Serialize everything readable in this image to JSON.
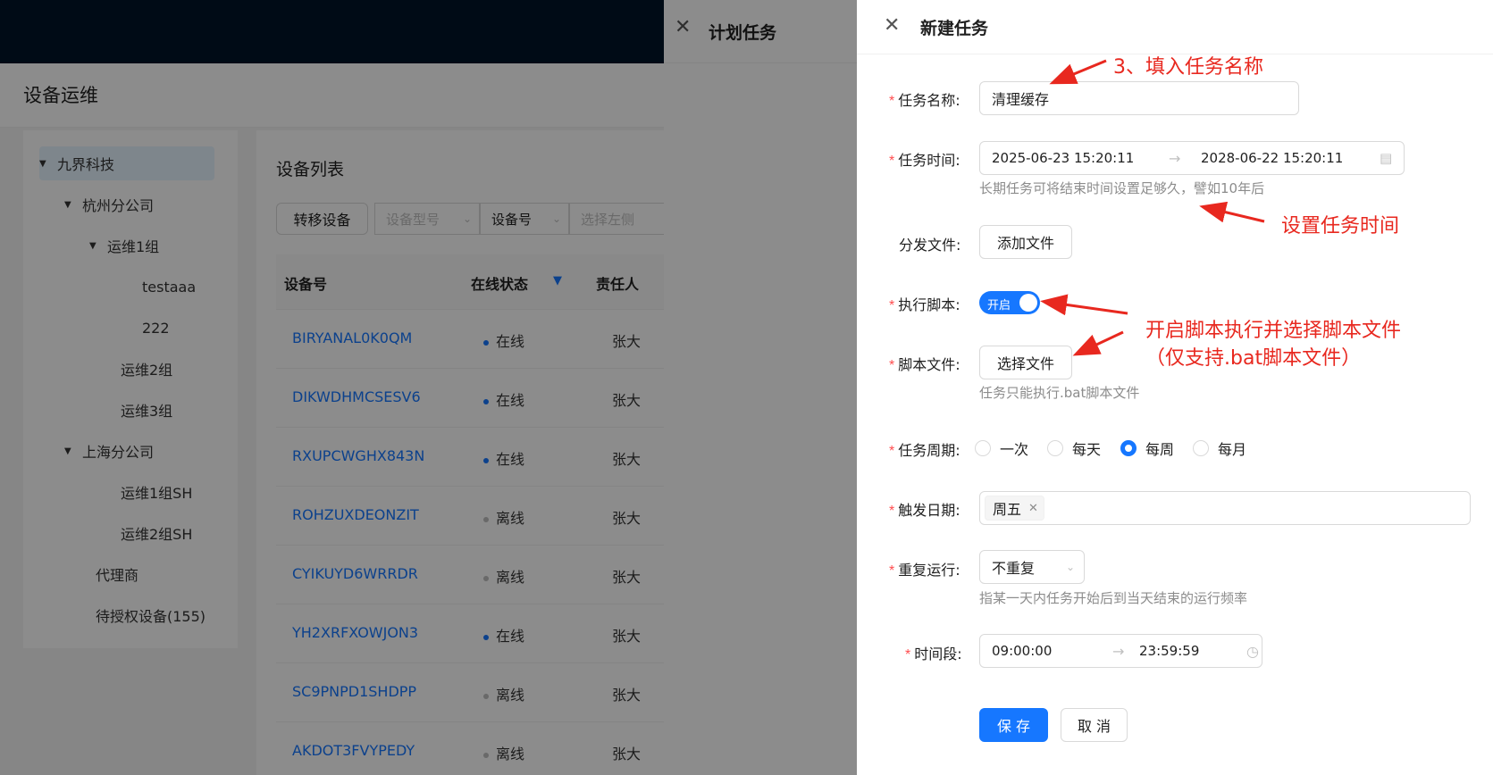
{
  "background": {
    "page_title": "设备运维",
    "tree": [
      {
        "label": "九界科技",
        "caret": "▼"
      },
      {
        "label": "杭州分公司",
        "caret": "▼"
      },
      {
        "label": "运维1组",
        "caret": "▼"
      },
      {
        "label": "testaaa",
        "caret": ""
      },
      {
        "label": "222",
        "caret": ""
      },
      {
        "label": "运维2组",
        "caret": ""
      },
      {
        "label": "运维3组",
        "caret": ""
      },
      {
        "label": "上海分公司",
        "caret": "▼"
      },
      {
        "label": "运维1组SH",
        "caret": ""
      },
      {
        "label": "运维2组SH",
        "caret": ""
      },
      {
        "label": "代理商",
        "caret": ""
      },
      {
        "label": "待授权设备(155)",
        "caret": ""
      }
    ],
    "list_title": "设备列表",
    "transfer_button": "转移设备",
    "filters": [
      "设备型号",
      "设备号",
      "选择左侧"
    ],
    "columns": [
      "设备号",
      "在线状态",
      "责任人"
    ],
    "rows": [
      {
        "id": "BIRYANAL0K0QM",
        "status": "在线",
        "owner": "张大"
      },
      {
        "id": "DIKWDHMCSESV6",
        "status": "在线",
        "owner": "张大"
      },
      {
        "id": "RXUPCWGHX843N",
        "status": "在线",
        "owner": "张大"
      },
      {
        "id": "ROHZUXDEONZIT",
        "status": "离线",
        "owner": "张大"
      },
      {
        "id": "CYIKUYD6WRRDR",
        "status": "离线",
        "owner": "张大"
      },
      {
        "id": "YH2XRFXOWJON3",
        "status": "在线",
        "owner": "张大"
      },
      {
        "id": "SC9PNPD1SHDPP",
        "status": "离线",
        "owner": "张大"
      },
      {
        "id": "AKDOT3FVYPEDY",
        "status": "离线",
        "owner": "张大"
      }
    ]
  },
  "drawer_plan": {
    "title": "计划任务",
    "close_icon": "close-icon"
  },
  "drawer_new": {
    "title": "新建任务",
    "close_icon": "close-icon",
    "task_name": {
      "label": "任务名称:",
      "value": "清理缓存"
    },
    "task_time": {
      "label": "任务时间:",
      "start": "2025-06-23 15:20:11",
      "end": "2028-06-22 15:20:11",
      "help": "长期任务可将结束时间设置足够久，譬如10年后"
    },
    "dist_file": {
      "label": "分发文件:",
      "button": "添加文件"
    },
    "exec_script": {
      "label": "执行脚本:",
      "switch_text": "开启",
      "enabled": true
    },
    "script_file": {
      "label": "脚本文件:",
      "button": "选择文件",
      "help": "任务只能执行.bat脚本文件"
    },
    "task_cycle": {
      "label": "任务周期:",
      "options": [
        "一次",
        "每天",
        "每周",
        "每月"
      ],
      "selected": "每周"
    },
    "trigger_date": {
      "label": "触发日期:",
      "tag": "周五"
    },
    "repeat": {
      "label": "重复运行:",
      "value": "不重复",
      "help": "指某一天内任务开始后到当天结束的运行频率"
    },
    "time_range": {
      "label": "时间段:",
      "start": "09:00:00",
      "end": "23:59:59"
    },
    "save_button": "保 存",
    "cancel_button": "取 消"
  },
  "annotations": {
    "a1": "3、填入任务名称",
    "a2": "设置任务时间",
    "a3_line1": "开启脚本执行并选择脚本文件",
    "a3_line2": "（仅支持.bat脚本文件）"
  },
  "colors": {
    "primary": "#1677ff",
    "annotation": "#e8281f",
    "online_dot": "#1677ff",
    "offline_dot": "#bfbfbf"
  }
}
